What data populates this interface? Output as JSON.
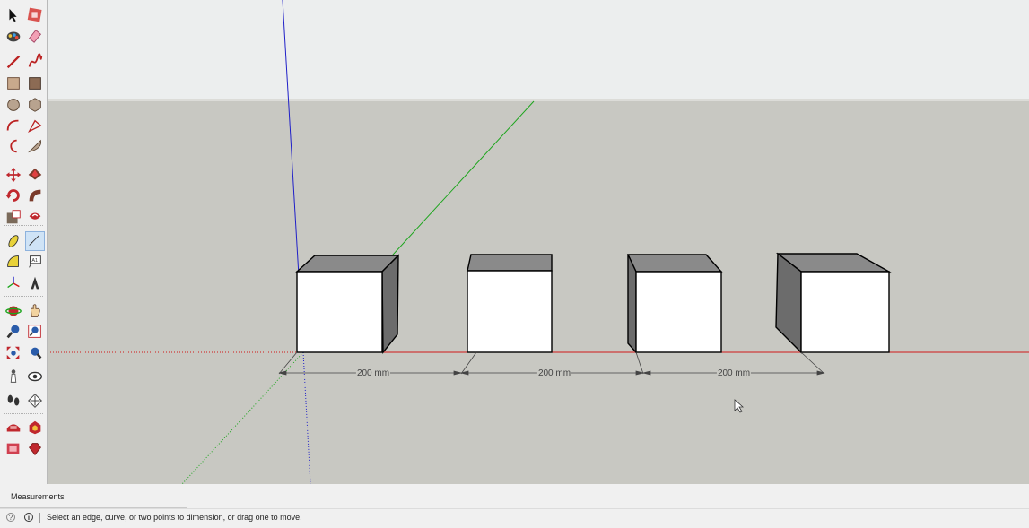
{
  "app": {
    "colors": {
      "sky": "#eceeee",
      "ground": "#c8c8c2",
      "horizon": "#dcdcd8",
      "axis_red": "#d01818",
      "axis_green": "#1ca51c",
      "axis_blue": "#2020c8",
      "cube_front": "#ffffff",
      "cube_top": "#8a8a8a",
      "cube_side": "#6c6c6c"
    }
  },
  "toolbar": {
    "rows": [
      [
        "select-icon",
        "component-icon"
      ],
      [
        "paint-bucket-icon",
        "eraser-icon"
      ],
      [
        "line-icon",
        "freehand-icon"
      ],
      [
        "rectangle-icon",
        "rotated-rectangle-icon"
      ],
      [
        "circle-icon",
        "polygon-icon"
      ],
      [
        "arc-icon",
        "two-point-arc-icon"
      ],
      [
        "three-point-arc-icon",
        "pie-icon"
      ],
      [
        "move-icon",
        "push-pull-icon"
      ],
      [
        "rotate-icon",
        "follow-me-icon"
      ],
      [
        "scale-icon",
        "offset-icon"
      ],
      [
        "tape-measure-icon",
        "dimension-icon"
      ],
      [
        "protractor-icon",
        "text-icon"
      ],
      [
        "axes-icon",
        "3d-text-icon"
      ],
      [
        "orbit-icon",
        "pan-icon"
      ],
      [
        "zoom-icon",
        "zoom-window-icon"
      ],
      [
        "zoom-extents-icon",
        "previous-view-icon"
      ],
      [
        "position-camera-icon",
        "look-around-icon"
      ],
      [
        "walk-icon",
        "section-plane-icon"
      ],
      [
        "warehouse-icon",
        "extension-warehouse-icon"
      ],
      [
        "layout-icon",
        "ruby-icon"
      ]
    ],
    "active_tool": "dimension-icon"
  },
  "dimensions": [
    {
      "label": "200 mm"
    },
    {
      "label": "200 mm"
    },
    {
      "label": "200 mm"
    }
  ],
  "measurements": {
    "label": "Measurements"
  },
  "status": {
    "hint": "Select an edge, curve, or two points to dimension, or drag one to move."
  }
}
